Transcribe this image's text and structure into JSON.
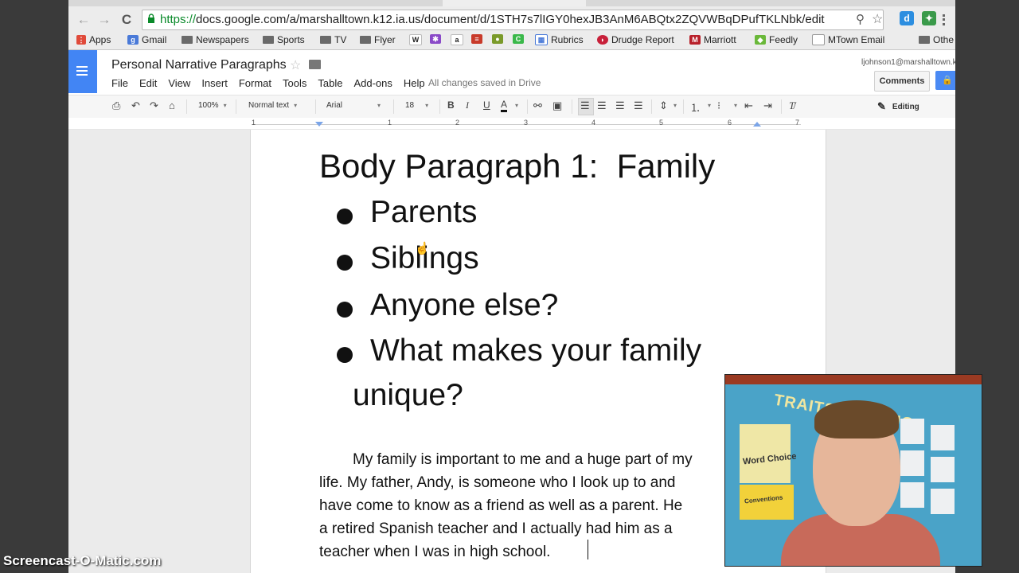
{
  "browser": {
    "url_scheme": "https://",
    "url_rest": "docs.google.com/a/marshalltown.k12.ia.us/document/d/1STH7s7lIGY0hexJB3AnM6ABQtx2ZQVWBqDPufTKLNbk/edit",
    "back_icon": "←",
    "forward_icon": "→",
    "reload_icon": "C",
    "search_icon": "⚲",
    "star_icon": "☆"
  },
  "bookmarks": [
    {
      "label": "Apps"
    },
    {
      "label": "Gmail"
    },
    {
      "label": "Newspapers"
    },
    {
      "label": "Sports"
    },
    {
      "label": "TV"
    },
    {
      "label": "Flyer"
    },
    {
      "label": "Rubrics"
    },
    {
      "label": "Drudge Report"
    },
    {
      "label": "Marriott"
    },
    {
      "label": "Feedly"
    },
    {
      "label": "MTown Email"
    },
    {
      "label": "Othe"
    }
  ],
  "docs": {
    "title": "Personal Narrative Paragraphs",
    "menu": [
      "File",
      "Edit",
      "View",
      "Insert",
      "Format",
      "Tools",
      "Table",
      "Add-ons",
      "Help"
    ],
    "save_status": "All changes saved in Drive",
    "user_email": "ljohnson1@marshalltown.k",
    "comments_label": "Comments",
    "share_icon": "🔒"
  },
  "toolbar": {
    "zoom": "100%",
    "style": "Normal text",
    "font": "Arial",
    "size": "18",
    "bold": "B",
    "italic": "I",
    "underline": "U",
    "text_color": "A",
    "editing_label": "Editing"
  },
  "ruler": {
    "numbers": [
      "1",
      "1",
      "2",
      "3",
      "4",
      "5",
      "6",
      "7"
    ]
  },
  "document": {
    "heading": "Body Paragraph 1:  Family",
    "bullets": [
      "Parents",
      "Siblings",
      "Anyone else?",
      "What makes your family"
    ],
    "bullet_continuation": "unique?",
    "body_lines": [
      "My family is important to me and a huge part of my",
      "life.  My father, Andy, is someone who I look up to and",
      "have come to know as a friend as well as a parent.  He",
      "a retired Spanish teacher and I actually had him as a",
      "teacher when I was in high school. "
    ]
  },
  "webcam": {
    "board_title": "TRAITS WRITING",
    "card_word_choice": "Word Choice",
    "card_conventions": "Conventions"
  },
  "watermark": "Screencast-O-Matic.com"
}
